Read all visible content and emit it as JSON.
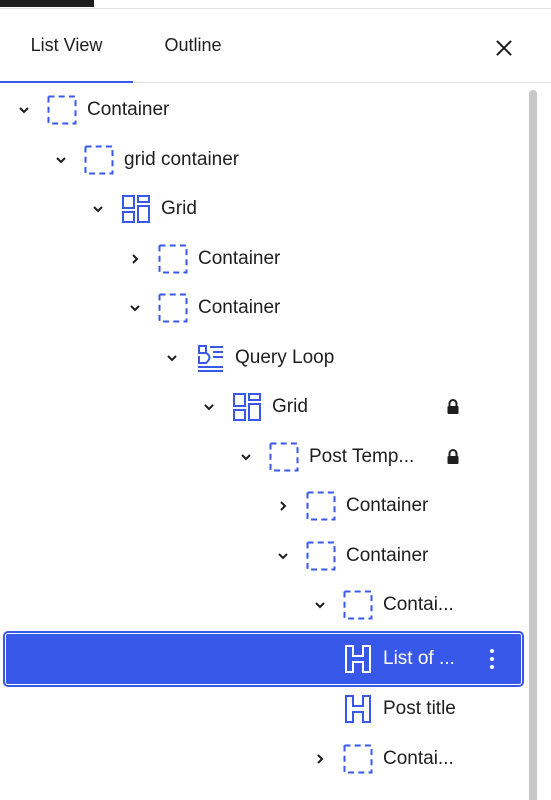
{
  "tabs": {
    "list_view": "List View",
    "outline": "Outline"
  },
  "icons": {
    "close": "close-icon",
    "chevron_down": "chevron-down-icon",
    "chevron_right": "chevron-right-icon",
    "container": "container-block-icon",
    "grid": "grid-block-icon",
    "query_loop": "query-loop-block-icon",
    "heading": "heading-block-icon",
    "lock": "lock-icon",
    "more": "more-vertical-icon"
  },
  "colors": {
    "accent": "#3858e9",
    "text": "#1e1e1e",
    "selected_text": "#ffffff"
  },
  "tree": [
    {
      "label": "Container",
      "icon": "container",
      "expanded": true,
      "locked": false,
      "selected": false
    },
    {
      "label": "grid container",
      "icon": "container",
      "expanded": true,
      "locked": false,
      "selected": false
    },
    {
      "label": "Grid",
      "icon": "grid",
      "expanded": true,
      "locked": false,
      "selected": false
    },
    {
      "label": "Container",
      "icon": "container",
      "expanded": false,
      "locked": false,
      "selected": false
    },
    {
      "label": "Container",
      "icon": "container",
      "expanded": true,
      "locked": false,
      "selected": false
    },
    {
      "label": "Query Loop",
      "icon": "query_loop",
      "expanded": true,
      "locked": false,
      "selected": false
    },
    {
      "label": "Grid",
      "icon": "grid",
      "expanded": true,
      "locked": true,
      "selected": false
    },
    {
      "label": "Post Temp...",
      "icon": "container",
      "expanded": true,
      "locked": true,
      "selected": false
    },
    {
      "label": "Container",
      "icon": "container",
      "expanded": false,
      "locked": false,
      "selected": false
    },
    {
      "label": "Container",
      "icon": "container",
      "expanded": true,
      "locked": false,
      "selected": false
    },
    {
      "label": "Contai...",
      "icon": "container",
      "expanded": true,
      "locked": false,
      "selected": false
    },
    {
      "label": "List of ...",
      "icon": "heading",
      "expanded": null,
      "locked": false,
      "selected": true
    },
    {
      "label": "Post title",
      "icon": "heading",
      "expanded": null,
      "locked": false,
      "selected": false
    },
    {
      "label": "Contai...",
      "icon": "container",
      "expanded": false,
      "locked": false,
      "selected": false
    }
  ]
}
